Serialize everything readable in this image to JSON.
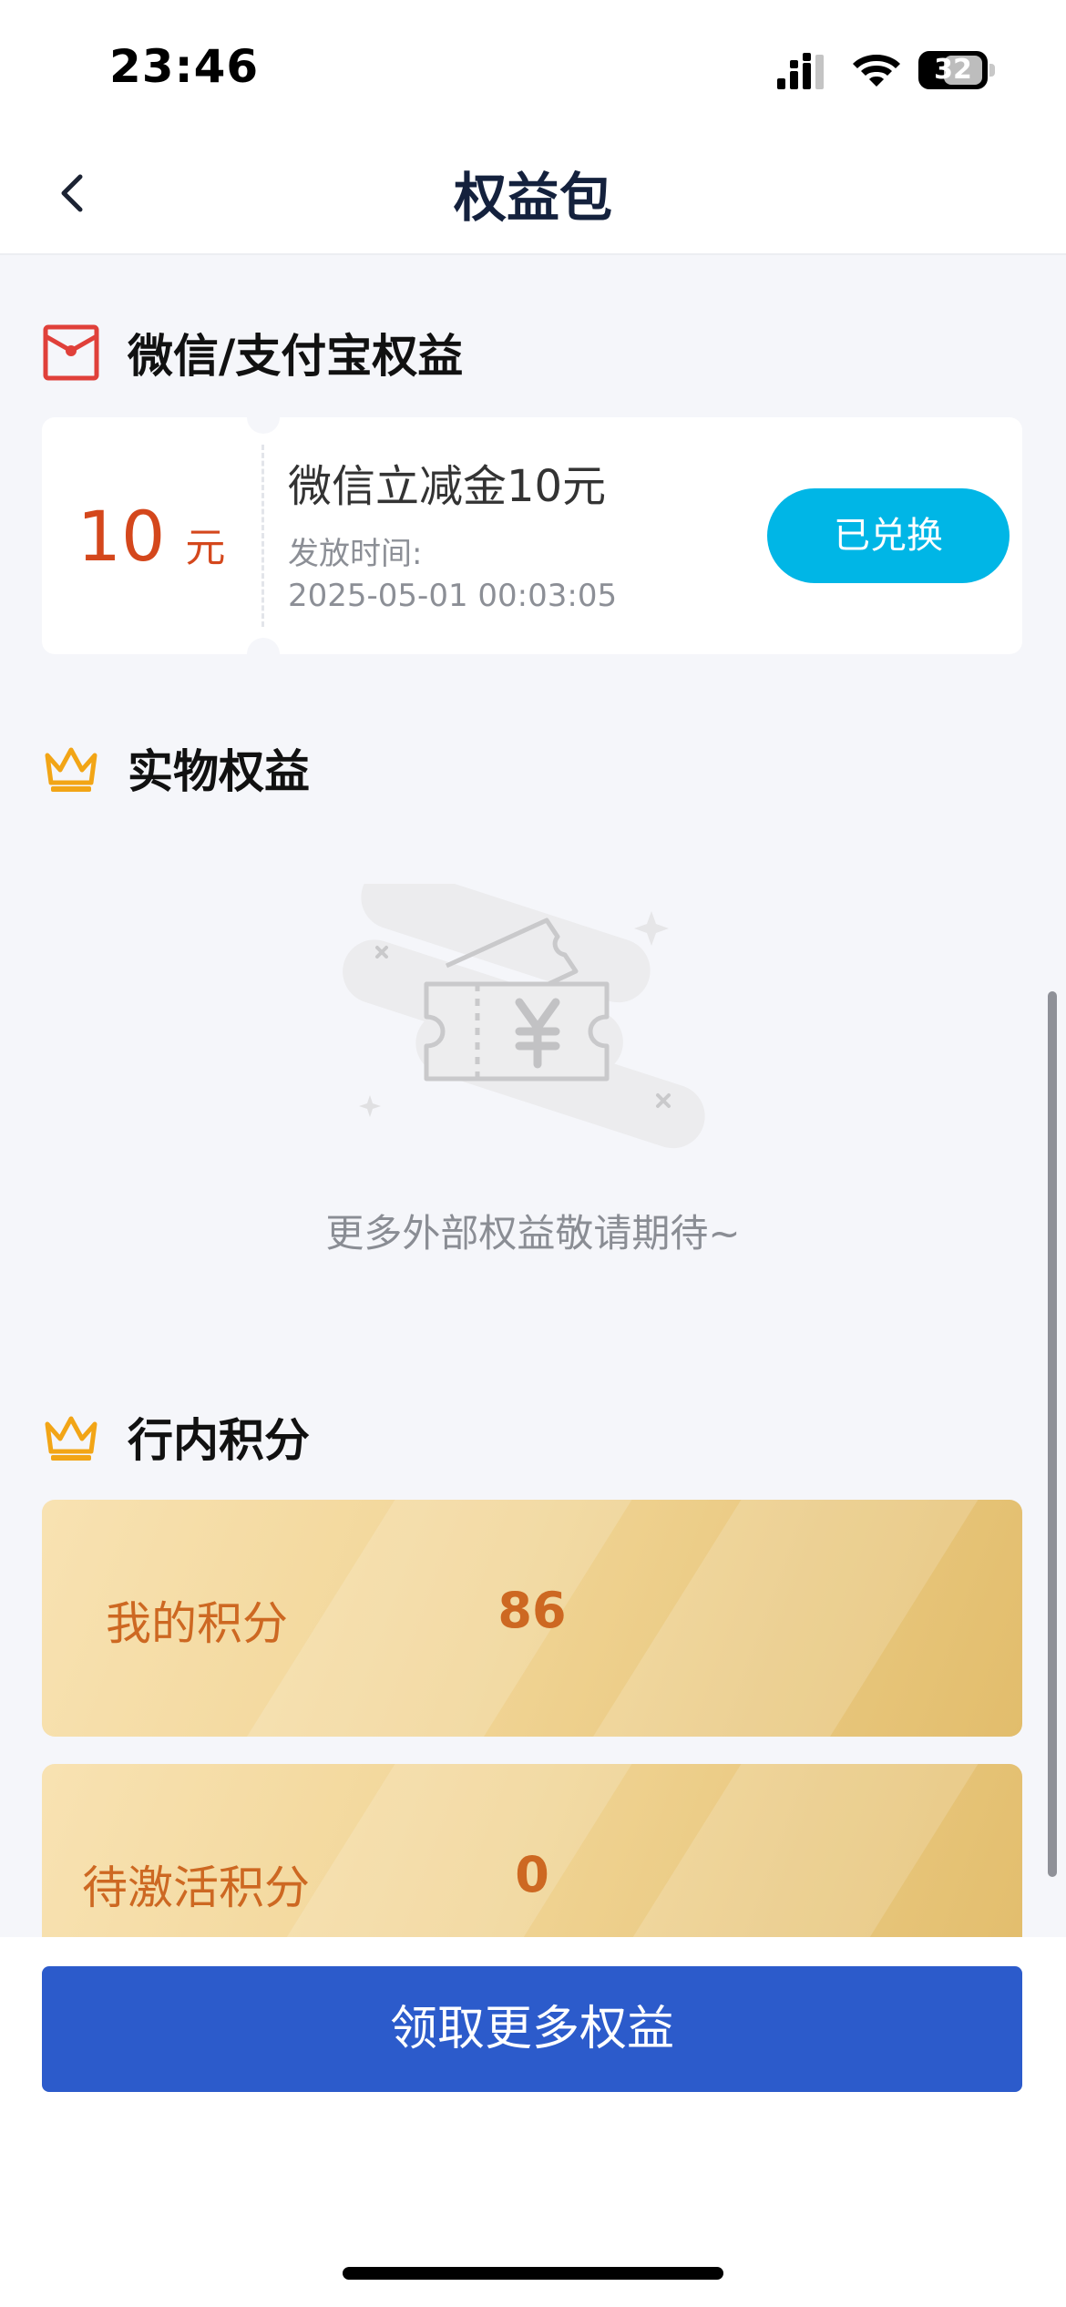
{
  "status_bar": {
    "time": "23:46",
    "battery": "32",
    "icons": [
      "signal-icon",
      "wifi-icon",
      "battery-icon"
    ]
  },
  "nav": {
    "title": "权益包",
    "back_icon": "chevron-left-icon"
  },
  "wechat_alipay_section": {
    "title": "微信/支付宝权益",
    "icon": "red-envelope-icon",
    "coupon": {
      "amount": "10",
      "unit": "元",
      "name": "微信立减金10元",
      "date_label": "发放时间:",
      "date": "2025-05-01 00:03:05",
      "status_button": "已兑换"
    }
  },
  "physical_section": {
    "title": "实物权益",
    "icon": "crown-icon",
    "empty_text": "更多外部权益敬请期待~",
    "empty_icon": "yuan-ticket-icon"
  },
  "points_section": {
    "title": "行内积分",
    "icon": "crown-icon",
    "cards": [
      {
        "label": "我的积分",
        "value": "86"
      },
      {
        "label": "待激活积分",
        "value": "0"
      }
    ]
  },
  "bottom": {
    "button_label": "领取更多权益"
  },
  "colors": {
    "primary_blue": "#2c5bcb",
    "redeem_cyan": "#00b6e6",
    "amount_red": "#d4471c",
    "points_orange": "#cd6822",
    "crown_gold": "#f2a516",
    "envelope_red": "#e0403a"
  }
}
